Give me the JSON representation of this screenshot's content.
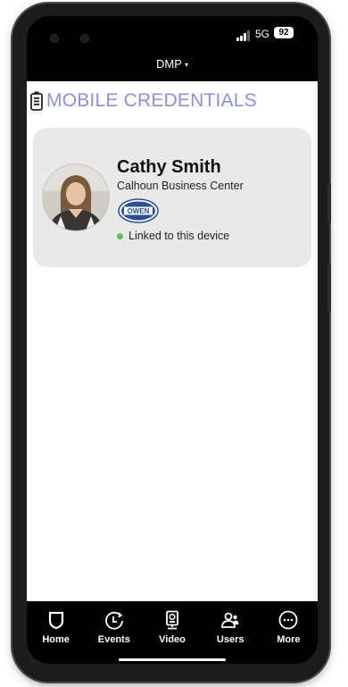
{
  "status_bar": {
    "network": "5G",
    "battery": "92"
  },
  "header": {
    "title": "DMP",
    "caret": "▾"
  },
  "section": {
    "title": "MOBILE CREDENTIALS"
  },
  "credential": {
    "name": "Cathy Smith",
    "organization": "Calhoun Business Center",
    "logo_text": "OWEN",
    "link_status": "Linked to this device"
  },
  "nav": {
    "items": [
      {
        "label": "Home",
        "icon": "shield-icon"
      },
      {
        "label": "Events",
        "icon": "clock-icon"
      },
      {
        "label": "Video",
        "icon": "camera-icon"
      },
      {
        "label": "Users",
        "icon": "users-icon"
      },
      {
        "label": "More",
        "icon": "more-icon"
      }
    ]
  },
  "colors": {
    "accent": "#8b93d6",
    "status_green": "#58c35a",
    "card_bg": "#e9e9ea"
  }
}
